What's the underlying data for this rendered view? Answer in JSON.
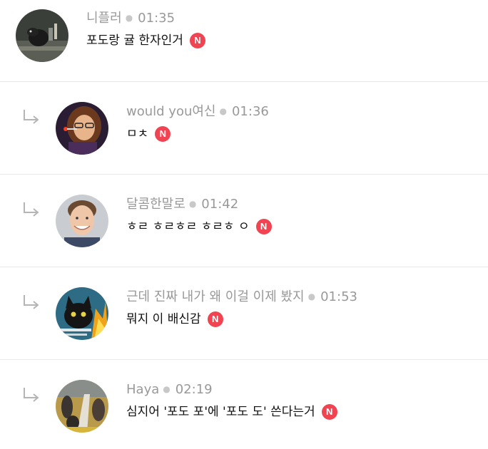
{
  "comments": [
    {
      "author": "니플러",
      "time": "01:35",
      "text": "포도랑 귤 한자인거",
      "badge": "N",
      "is_reply": false,
      "avatar_icon": "niffler-avatar"
    },
    {
      "author": "would you여신",
      "time": "01:36",
      "text": "ㅁㅊ",
      "badge": "N",
      "is_reply": true,
      "avatar_icon": "cartoon-woman-avatar"
    },
    {
      "author": "달콤한말로",
      "time": "01:42",
      "text": "ㅎㄹ ㅎㄹㅎㄹ ㅎㄹㅎ ㅇ",
      "badge": "N",
      "is_reply": true,
      "avatar_icon": "smiling-man-avatar"
    },
    {
      "author": "근데 진짜 내가 왜 이걸 이제 봤지",
      "time": "01:53",
      "text": "뭐지 이 배신감",
      "badge": "N",
      "is_reply": true,
      "avatar_icon": "black-cat-fire-avatar"
    },
    {
      "author": "Haya",
      "time": "02:19",
      "text": "심지어 '포도 포'에 '포도 도' 쓴다는거",
      "badge": "N",
      "is_reply": true,
      "avatar_icon": "crowd-photo-avatar"
    }
  ],
  "colors": {
    "meta_text": "#999999",
    "body_text": "#111111",
    "new_badge": "#f04452",
    "divider": "#e9e9e9",
    "reply_arrow": "#b5b5b5"
  }
}
